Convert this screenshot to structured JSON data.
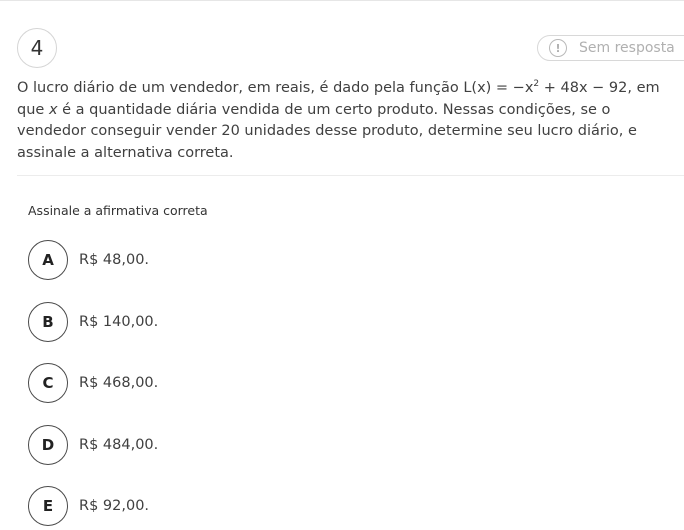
{
  "question": {
    "number": "4",
    "status": {
      "icon": "alert-icon",
      "icon_glyph": "!",
      "label": "Sem resposta"
    },
    "statement": {
      "part1": "O lucro diário de um vendedor, em reais, é dado pela função L(x) = −x",
      "sup": "2",
      "part2": " + 48x − 92, em que ",
      "var": "x",
      "part3": " é a quantidade diária vendida de um certo produto. Nessas condições, se o vendedor conseguir vender 20 unidades desse produto, determine seu lucro diário, e assinale a alternativa correta."
    },
    "instruction": "Assinale a afirmativa correta",
    "options": [
      {
        "letter": "A",
        "text": "R$ 48,00."
      },
      {
        "letter": "B",
        "text": "R$ 140,00."
      },
      {
        "letter": "C",
        "text": "R$ 468,00."
      },
      {
        "letter": "D",
        "text": "R$ 484,00."
      },
      {
        "letter": "E",
        "text": "R$ 92,00."
      }
    ]
  }
}
